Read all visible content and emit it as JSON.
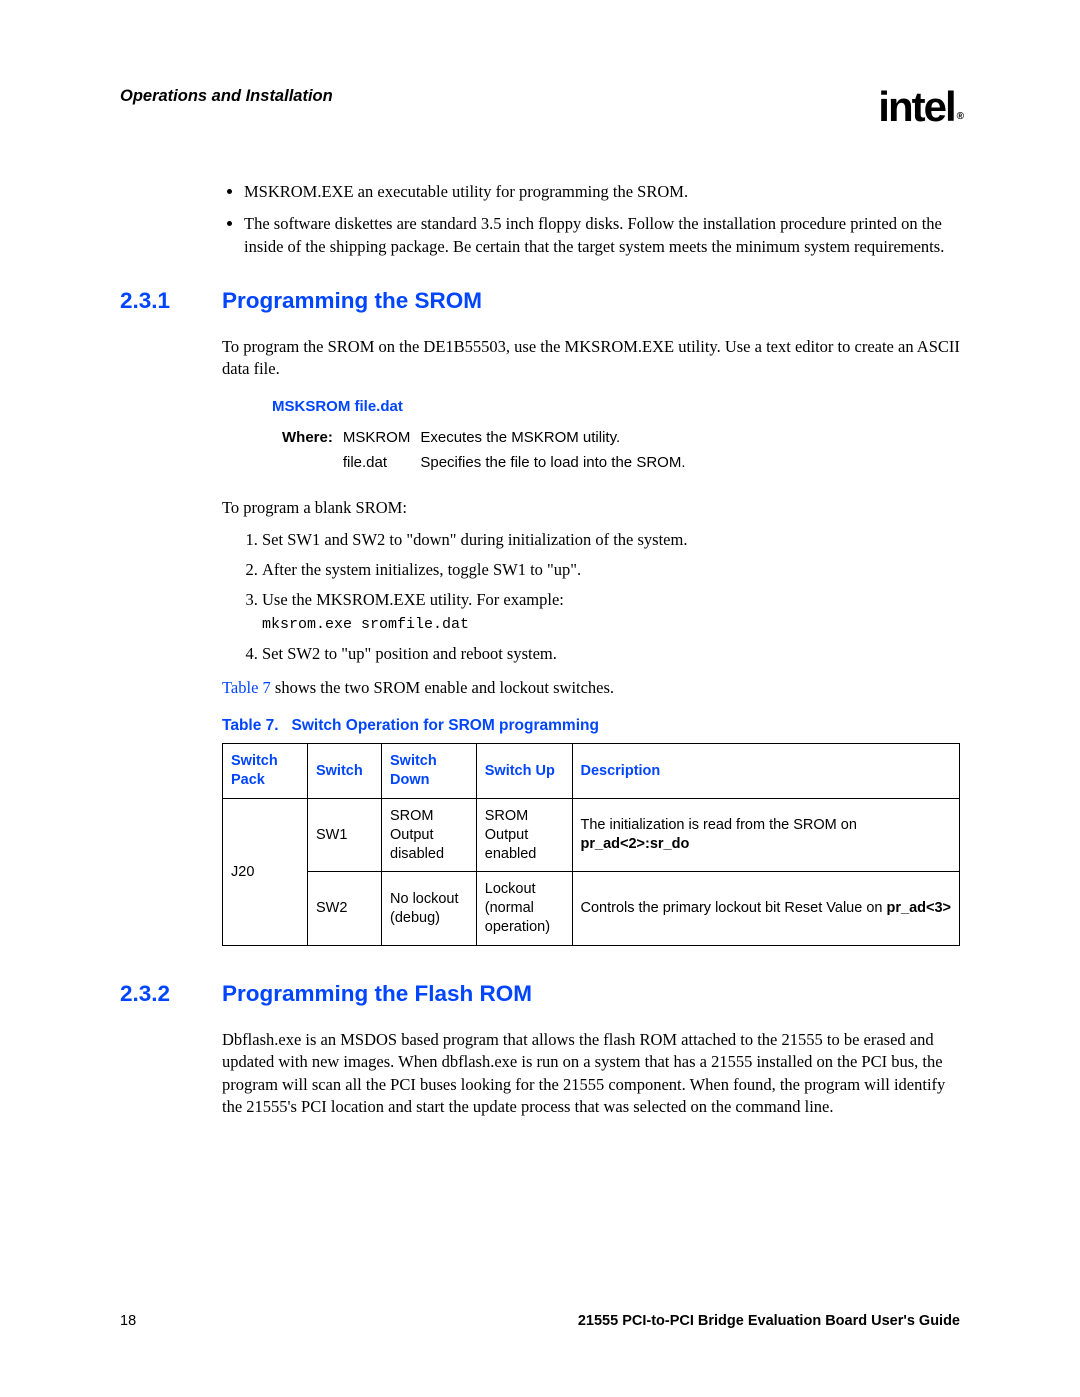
{
  "header": {
    "section_title": "Operations and Installation",
    "logo_text": "intel",
    "logo_mark": "®"
  },
  "intro_bullets": [
    "MSKROM.EXE an executable utility for programming the SROM.",
    "The software diskettes are standard 3.5 inch floppy disks. Follow the installation procedure printed on the inside of the shipping package. Be certain that the target system meets the minimum system requirements."
  ],
  "sec231": {
    "num": "2.3.1",
    "title": "Programming the SROM",
    "para1": "To program the SROM on the DE1B55503, use the MKSROM.EXE utility. Use a text editor to create an ASCII data file.",
    "cmd_title": "MSKSROM file.dat",
    "where_label": "Where:",
    "where_rows": [
      {
        "term": "MSKROM",
        "desc": "Executes the MSKROM utility."
      },
      {
        "term": "file.dat",
        "desc": "Specifies the file to load into the SROM."
      }
    ],
    "para2": "To program a blank SROM:",
    "steps": [
      "Set SW1 and SW2 to \"down\" during initialization of the system.",
      "After the system initializes, toggle SW1 to \"up\".",
      "Use the MKSROM.EXE utility. For example:",
      "Set SW2 to \"up\" position and reboot system."
    ],
    "step3_code": "mksrom.exe sromfile.dat",
    "table_link": "Table 7",
    "after_link": " shows the two SROM enable and lockout switches.",
    "table_caption_prefix": "Table 7.",
    "table_caption_title": "Switch Operation for SROM programming",
    "table_headers": [
      "Switch Pack",
      "Switch",
      "Switch Down",
      "Switch Up",
      "Description"
    ],
    "table_rows": [
      {
        "pack": "J20",
        "sw": "SW1",
        "down": "SROM Output disabled",
        "up": "SROM Output enabled",
        "desc_pre": "The initialization is read from the SROM on ",
        "desc_bold": "pr_ad<2>:sr_do"
      },
      {
        "sw": "SW2",
        "down": "No lockout (debug)",
        "up": "Lockout (normal operation)",
        "desc_pre": "Controls the primary lockout bit Reset Value on ",
        "desc_bold": "pr_ad<3>"
      }
    ]
  },
  "sec232": {
    "num": "2.3.2",
    "title": "Programming the Flash ROM",
    "para1": "Dbflash.exe is an MSDOS based program that allows the flash ROM attached to the 21555 to be erased and updated with new images. When dbflash.exe is run on a system that has a 21555 installed on the PCI bus, the program will scan all the PCI buses looking for the 21555 component. When found, the program will identify the 21555's PCI location and start the update process that was selected on the command line."
  },
  "footer": {
    "page": "18",
    "doc_title": "21555 PCI-to-PCI Bridge Evaluation Board User's Guide"
  }
}
